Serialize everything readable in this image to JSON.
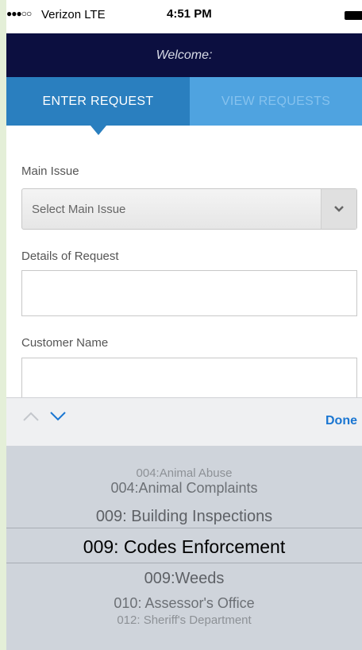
{
  "status_bar": {
    "signal": "●●●○○",
    "carrier": "Verizon  LTE",
    "time": "4:51 PM"
  },
  "header": {
    "welcome": "Welcome:"
  },
  "tabs": [
    {
      "label": "ENTER REQUEST",
      "active": true
    },
    {
      "label": "VIEW REQUESTS",
      "active": false
    }
  ],
  "form": {
    "main_issue_label": "Main Issue",
    "main_issue_value": "Select Main Issue",
    "details_label": "Details of Request",
    "details_value": "",
    "customer_label": "Customer Name",
    "customer_value": ""
  },
  "accessory": {
    "done_label": "Done"
  },
  "picker": {
    "options": [
      "004:Animal Abuse",
      "004:Animal Complaints",
      "009: Building Inspections",
      "009: Codes Enforcement",
      "009:Weeds",
      "010: Assessor's Office",
      "012: Sheriff's Department"
    ],
    "selected": "009: Codes Enforcement"
  },
  "colors": {
    "header_bg": "#0c0f40",
    "tab_active": "#2a7fbf",
    "tab_inactive": "#4fa3e0",
    "accent": "#1a76d2"
  }
}
